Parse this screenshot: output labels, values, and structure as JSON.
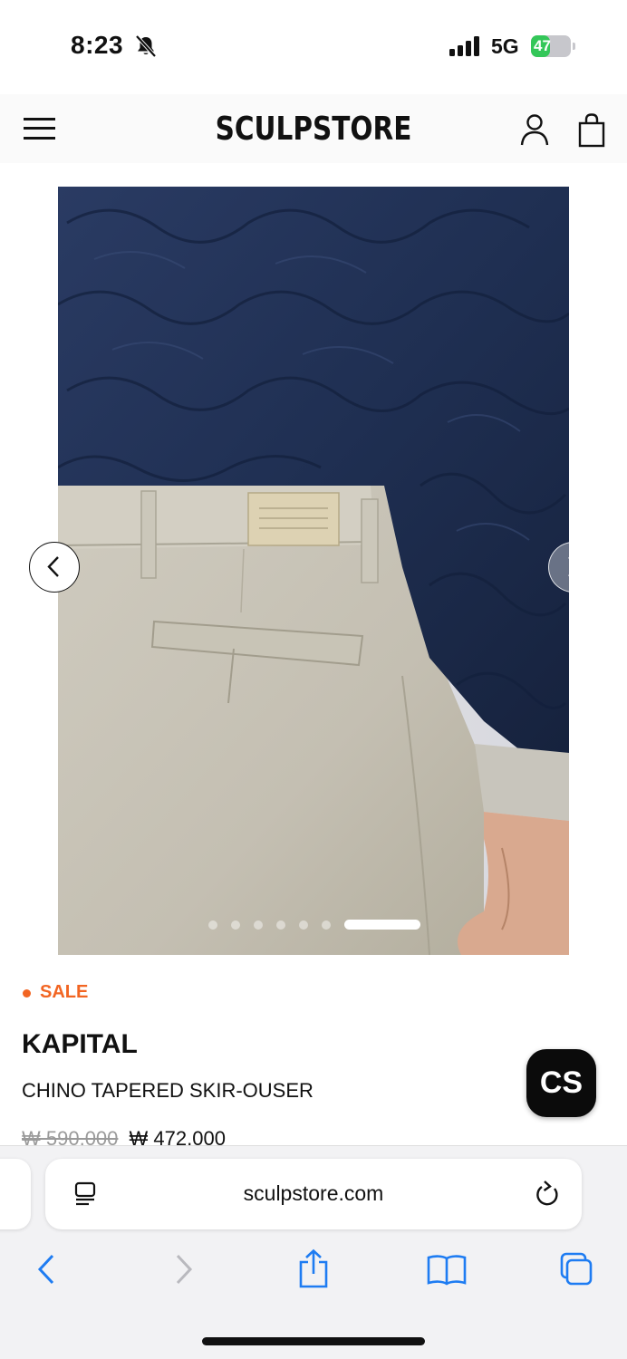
{
  "status_bar": {
    "time": "8:23",
    "network": "5G",
    "battery_level": "47",
    "battery_fraction": 0.47
  },
  "header": {
    "logo": "SCULPSTORE"
  },
  "carousel": {
    "image_description": "Kapital chino tapered skirt-trousers in beige worn with navy quilted jacket",
    "slide_count": 7,
    "active_slide": 7
  },
  "product": {
    "badge": "SALE",
    "brand": "KAPITAL",
    "name": "CHINO TAPERED SKIR-OUSER",
    "original_price": "₩ 590,000",
    "sale_price": "₩ 472,000"
  },
  "chat": {
    "label": "CS"
  },
  "browser": {
    "url": "sculpstore.com"
  },
  "colors": {
    "accent_sale": "#f26522",
    "ios_blue": "#1e7cf2",
    "jacket_navy": "#1f2f52",
    "pants_beige": "#c9c5b8"
  },
  "icons": {
    "menu": "hamburger-icon",
    "account": "user-icon",
    "cart": "bag-icon",
    "prev": "chevron-left-icon",
    "next": "chevron-right-icon",
    "reader": "reader-icon",
    "reload": "reload-icon",
    "share": "share-icon",
    "bookmarks": "book-icon",
    "tabs": "tabs-icon"
  }
}
